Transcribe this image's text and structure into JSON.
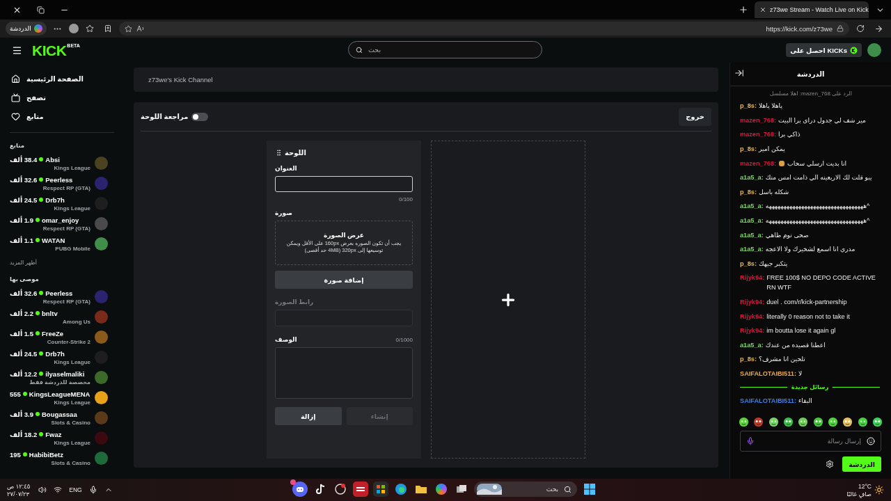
{
  "browser": {
    "tab_title": "z73we Stream - Watch Live on Kick",
    "profile_label": "الدردشة",
    "url": "https://kick.com/z73we"
  },
  "header": {
    "logo": "KICK",
    "logo_badge": "BETA",
    "search_placeholder": "بحث",
    "kicks_button": "احصل على KICKs"
  },
  "sidebar": {
    "nav": [
      {
        "label": "الصفحة الرئيسية",
        "kind": "home"
      },
      {
        "label": "تصفح",
        "kind": "browse"
      },
      {
        "label": "متابع",
        "kind": "following"
      }
    ],
    "sections": [
      {
        "title": "متابع",
        "channels": [
          {
            "name": "Absi",
            "viewers": "38.4 ألف",
            "category": "Kings League",
            "color": "#4a4220"
          },
          {
            "name": "Peerless",
            "viewers": "32.6 ألف",
            "category": "Respect RP (GTA)",
            "color": "#2c2370"
          },
          {
            "name": "Drb7h",
            "viewers": "24.5 ألف",
            "category": "Kings League",
            "color": "#1e1e1e"
          },
          {
            "name": "omar_enjoy",
            "viewers": "1.9 ألف",
            "category": "Respect RP (GTA)",
            "color": "#4a4a4a"
          },
          {
            "name": "WATAN",
            "viewers": "1.1 ألف",
            "category": "PUBG Mobile",
            "color": "#3f8f4a"
          }
        ],
        "more": "أظهر المزيد"
      },
      {
        "title": "موصى بها",
        "channels": [
          {
            "name": "Peerless",
            "viewers": "32.6 ألف",
            "category": "Respect RP (GTA)",
            "color": "#2c2370"
          },
          {
            "name": "bnltv",
            "viewers": "2.2 ألف",
            "category": "Among Us",
            "color": "#7a2a1a"
          },
          {
            "name": "FreeZe",
            "viewers": "1.5 ألف",
            "category": "Counter-Strike 2",
            "color": "#8a5a1a"
          },
          {
            "name": "Drb7h",
            "viewers": "24.5 ألف",
            "category": "Kings League",
            "color": "#1e1e1e"
          },
          {
            "name": "ilyaselmaliki",
            "viewers": "12.2 ألف",
            "category": "مخصصة للدردشة فقط",
            "color": "#3c6a2a"
          },
          {
            "name": "KingsLeagueMENA",
            "viewers": "555",
            "category": "Kings League",
            "color": "#e8a21a"
          },
          {
            "name": "Bougassaa",
            "viewers": "3.9 ألف",
            "category": "Slots & Casino",
            "color": "#5a3a1a"
          },
          {
            "name": "Fwaz",
            "viewers": "18.2 ألف",
            "category": "Kings League",
            "color": "#3a0a10"
          },
          {
            "name": "HabibiBetz",
            "viewers": "195",
            "category": "Slots & Casino",
            "color": "#1e6a3a"
          }
        ]
      }
    ]
  },
  "channel_card": {
    "title": "z73we's Kick Channel"
  },
  "panel_editor": {
    "review_toggle": {
      "label": "مراجعة اللوحة",
      "on": false
    },
    "exit_button": "خروج",
    "card": {
      "title": "اللوحة",
      "title_field": {
        "label": "العنوان",
        "counter": "0/100"
      },
      "image": {
        "label": "صورة",
        "drop_title": "عرض الصورة",
        "drop_text": "يجب أن تكون الصوره بعرض 160px على الأقل ويمكن توسيعها إلى 320px (4MB حد أقصى)",
        "add_button": "إضافة صورة"
      },
      "image_url": {
        "label": "رابط الصورة",
        "disabled": true
      },
      "description": {
        "label": "الوصف",
        "counter": "0/1000"
      },
      "remove_button": {
        "label": "إزالة",
        "disabled": false
      },
      "create_button": {
        "label": "إنشاء",
        "disabled": true
      }
    }
  },
  "chat": {
    "title": "الدردشة",
    "messages": [
      {
        "kind": "reply",
        "text": "الرد على mazen_768: اهلا مسلسل"
      },
      {
        "kind": "message",
        "user": "p_8s:",
        "color": "#e2b55a",
        "text": "ياهلا ياهلا"
      },
      {
        "kind": "message",
        "user": "mazen_768:",
        "color": "#d4173c",
        "text": "مير شف لي جدول دراي برا البيت"
      },
      {
        "kind": "message",
        "user": "mazen_768:",
        "color": "#d4173c",
        "text": "ذاكي برا"
      },
      {
        "kind": "message",
        "user": "p_8s:",
        "color": "#e2b55a",
        "text": "يمكن امير"
      },
      {
        "kind": "emote_message",
        "user": "mazen_768:",
        "color": "#d4173c",
        "text": "انا بديت ارسلي سحاب"
      },
      {
        "kind": "message",
        "user": "a1a5_a:",
        "color": "#7fd46a",
        "text": "يبو قلت لك الاربعينه الي ذامت امس منك"
      },
      {
        "kind": "message",
        "user": "p_8s:",
        "color": "#e2b55a",
        "text": "شكله باسل"
      },
      {
        "kind": "message",
        "user": "a1a5_a:",
        "color": "#7fd46a",
        "text": "^هههههههههههههههههههههههههههههههههه"
      },
      {
        "kind": "message",
        "user": "a1a5_a:",
        "color": "#7fd46a",
        "text": "^هههههههههههههههههههههههههههههههههه"
      },
      {
        "kind": "message",
        "user": "a1a5_a:",
        "color": "#7fd46a",
        "text": "صحى نوم ظاهي"
      },
      {
        "kind": "message",
        "user": "a1a5_a:",
        "color": "#7fd46a",
        "text": "مدري انا اسمع لشخيرك ولا الاعجه"
      },
      {
        "kind": "message",
        "user": "p_8s:",
        "color": "#e2b55a",
        "text": "يتكبر جيهك"
      },
      {
        "kind": "message",
        "user": "Rijyk94:",
        "color": "#d4173c",
        "text": "FREE 100$ NO DEPO CODE ACTIVE RN WTF"
      },
      {
        "kind": "message",
        "user": "Rijyk94:",
        "color": "#d4173c",
        "text": "duel . com/r/kick-partnership"
      },
      {
        "kind": "message",
        "user": "Rijyk94:",
        "color": "#d4173c",
        "text": "literally 0 reason not to take it"
      },
      {
        "kind": "message",
        "user": "Rijyk94:",
        "color": "#d4173c",
        "text": "im boutta lose it again gl"
      },
      {
        "kind": "message",
        "user": "a1a5_a:",
        "color": "#7fd46a",
        "text": "اعطنا قصيده من عندك"
      },
      {
        "kind": "message",
        "user": "p_8s:",
        "color": "#e2b55a",
        "text": "تلحين انا مشرف؟"
      },
      {
        "kind": "message",
        "user": "SAIFALOTAIBI511:",
        "color": "#e8a84a",
        "text": "لا"
      },
      {
        "kind": "divider",
        "text": "رسائل جديدة"
      },
      {
        "kind": "message",
        "user": "SAIFALOTAIBI511:",
        "color": "#3d7fe0",
        "text": "البقاء"
      }
    ],
    "input_placeholder": "إرسال رسالة",
    "send_button": "الدردشة"
  },
  "taskbar": {
    "time": "١٢:٤٥ ص",
    "date": "٢٧/٠٧/٢٣",
    "language": "ENG",
    "search_placeholder": "بحث",
    "temperature": "12°C",
    "weather": "صافٍ غالبًا"
  }
}
